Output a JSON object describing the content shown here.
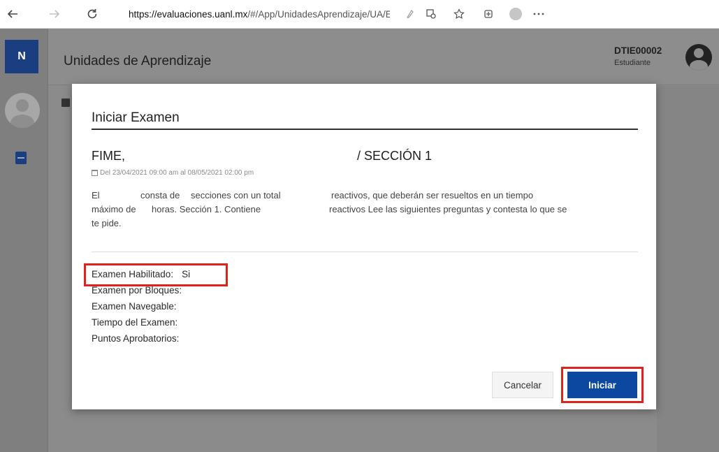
{
  "browser": {
    "url_host": "https://evaluaciones.uanl.mx",
    "url_path": "/#/App/UnidadesAprendizaje/UA/E...",
    "icons": [
      "back-arrow-icon",
      "forward-arrow-icon",
      "refresh-icon",
      "lock-icon",
      "read-aloud-icon",
      "collections-icon",
      "favorites-icon",
      "profile-icon",
      "more-icon"
    ]
  },
  "sidebar": {
    "logo": "N",
    "icons": [
      "user-avatar-icon",
      "book-icon"
    ]
  },
  "header": {
    "title": "Unidades de Aprendizaje",
    "user_id": "DTIE00002",
    "user_role": "Estudiante"
  },
  "modal": {
    "title": "Iniciar Examen",
    "exam_faculty": "FIME,",
    "exam_section": "/ SECCIÓN 1",
    "exam_dates": "Del 23/04/2021 09:00 am al 08/05/2021 02:00 pm",
    "description_fragments": {
      "l1_a": "El",
      "l1_b": "consta de",
      "l1_c": "secciones con un total",
      "l1_d": "reactivos, que deberán ser resueltos en un tiempo",
      "l2_a": "máximo de",
      "l2_b": "horas. Sección 1. Contiene",
      "l2_c": "reactivos Lee las siguientes preguntas y contesta lo que se",
      "l3": "te pide."
    },
    "details": [
      {
        "label": "Examen Habilitado:",
        "value": "Si"
      },
      {
        "label": "Examen por Bloques:",
        "value": ""
      },
      {
        "label": "Examen Navegable:",
        "value": ""
      },
      {
        "label": "Tiempo del Examen:",
        "value": ""
      },
      {
        "label": "Puntos Aprobatorios:",
        "value": ""
      }
    ],
    "cancel_label": "Cancelar",
    "start_label": "Iniciar"
  },
  "colors": {
    "brand_blue": "#0d48a0",
    "highlight_red": "#e0221e",
    "overlay_gray": "#8b8b8b"
  }
}
